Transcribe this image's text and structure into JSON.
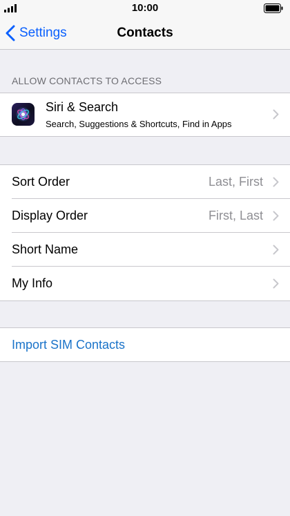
{
  "status_bar": {
    "time": "10:00",
    "signal_icon": "cellular-signal-icon",
    "battery_icon": "battery-full-icon"
  },
  "nav": {
    "back_label": "Settings",
    "title": "Contacts",
    "back_icon": "chevron-left-icon"
  },
  "access_section": {
    "header": "ALLOW CONTACTS TO ACCESS",
    "siri": {
      "title": "Siri & Search",
      "subtitle": "Search, Suggestions & Shortcuts, Find in Apps",
      "icon": "siri-icon"
    }
  },
  "settings": {
    "sort_order": {
      "label": "Sort Order",
      "value": "Last, First"
    },
    "display_order": {
      "label": "Display Order",
      "value": "First, Last"
    },
    "short_name": {
      "label": "Short Name"
    },
    "my_info": {
      "label": "My Info"
    }
  },
  "import": {
    "label": "Import SIM Contacts"
  },
  "colors": {
    "background": "#efeff4",
    "bar": "#f7f7f7",
    "accent": "#0a60fe",
    "link": "#1a73c9",
    "secondary_text": "#8e8e93",
    "separator": "#c8c7cc"
  }
}
